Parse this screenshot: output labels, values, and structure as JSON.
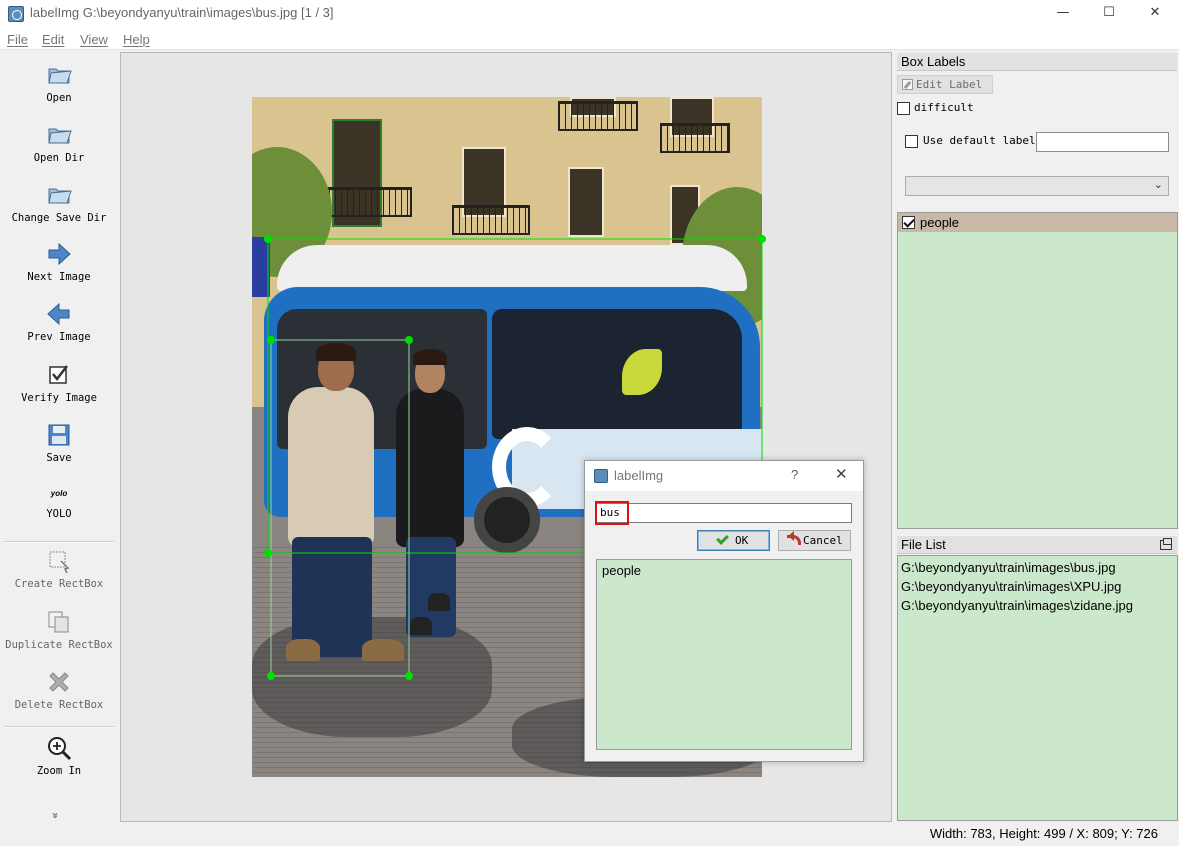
{
  "window": {
    "title": "labelImg G:\\beyondyanyu\\train\\images\\bus.jpg [1 / 3]",
    "minimize": "—",
    "maximize": "☐",
    "close": "✕"
  },
  "menu": [
    "File",
    "Edit",
    "View",
    "Help"
  ],
  "toolbar": {
    "open": "Open",
    "open_dir": "Open Dir",
    "change_save_dir": "Change Save Dir",
    "next_image": "Next Image",
    "prev_image": "Prev Image",
    "verify_image": "Verify Image",
    "save": "Save",
    "yolo_icon": "yolo",
    "yolo": "YOLO",
    "create_rectbox": "Create RectBox",
    "duplicate_rectbox": "Duplicate RectBox",
    "delete_rectbox": "Delete RectBox",
    "zoom_in": "Zoom In",
    "more": "»"
  },
  "box_labels": {
    "title": "Box Labels",
    "edit_label": "Edit Label",
    "difficult": "difficult",
    "difficult_checked": false,
    "use_default_label": "Use default label",
    "use_default_checked": false,
    "default_label_value": "",
    "combo_value": "",
    "labels": [
      {
        "name": "people",
        "checked": true
      }
    ]
  },
  "file_list": {
    "title": "File List",
    "files": [
      "G:\\beyondyanyu\\train\\images\\bus.jpg",
      "G:\\beyondyanyu\\train\\images\\XPU.jpg",
      "G:\\beyondyanyu\\train\\images\\zidane.jpg"
    ]
  },
  "status": "Width: 783, Height: 499 / X: 809; Y: 726",
  "dialog": {
    "title": "labelImg",
    "help": "?",
    "close": "✕",
    "input_value": "bus",
    "ok": "OK",
    "cancel": "Cancel",
    "suggestions": [
      "people"
    ]
  },
  "colors": {
    "bbox": "#00e000",
    "label_list_bg": "#cce8cc",
    "selected_label_bg": "#c8b8a6",
    "highlight": "#e01010"
  }
}
